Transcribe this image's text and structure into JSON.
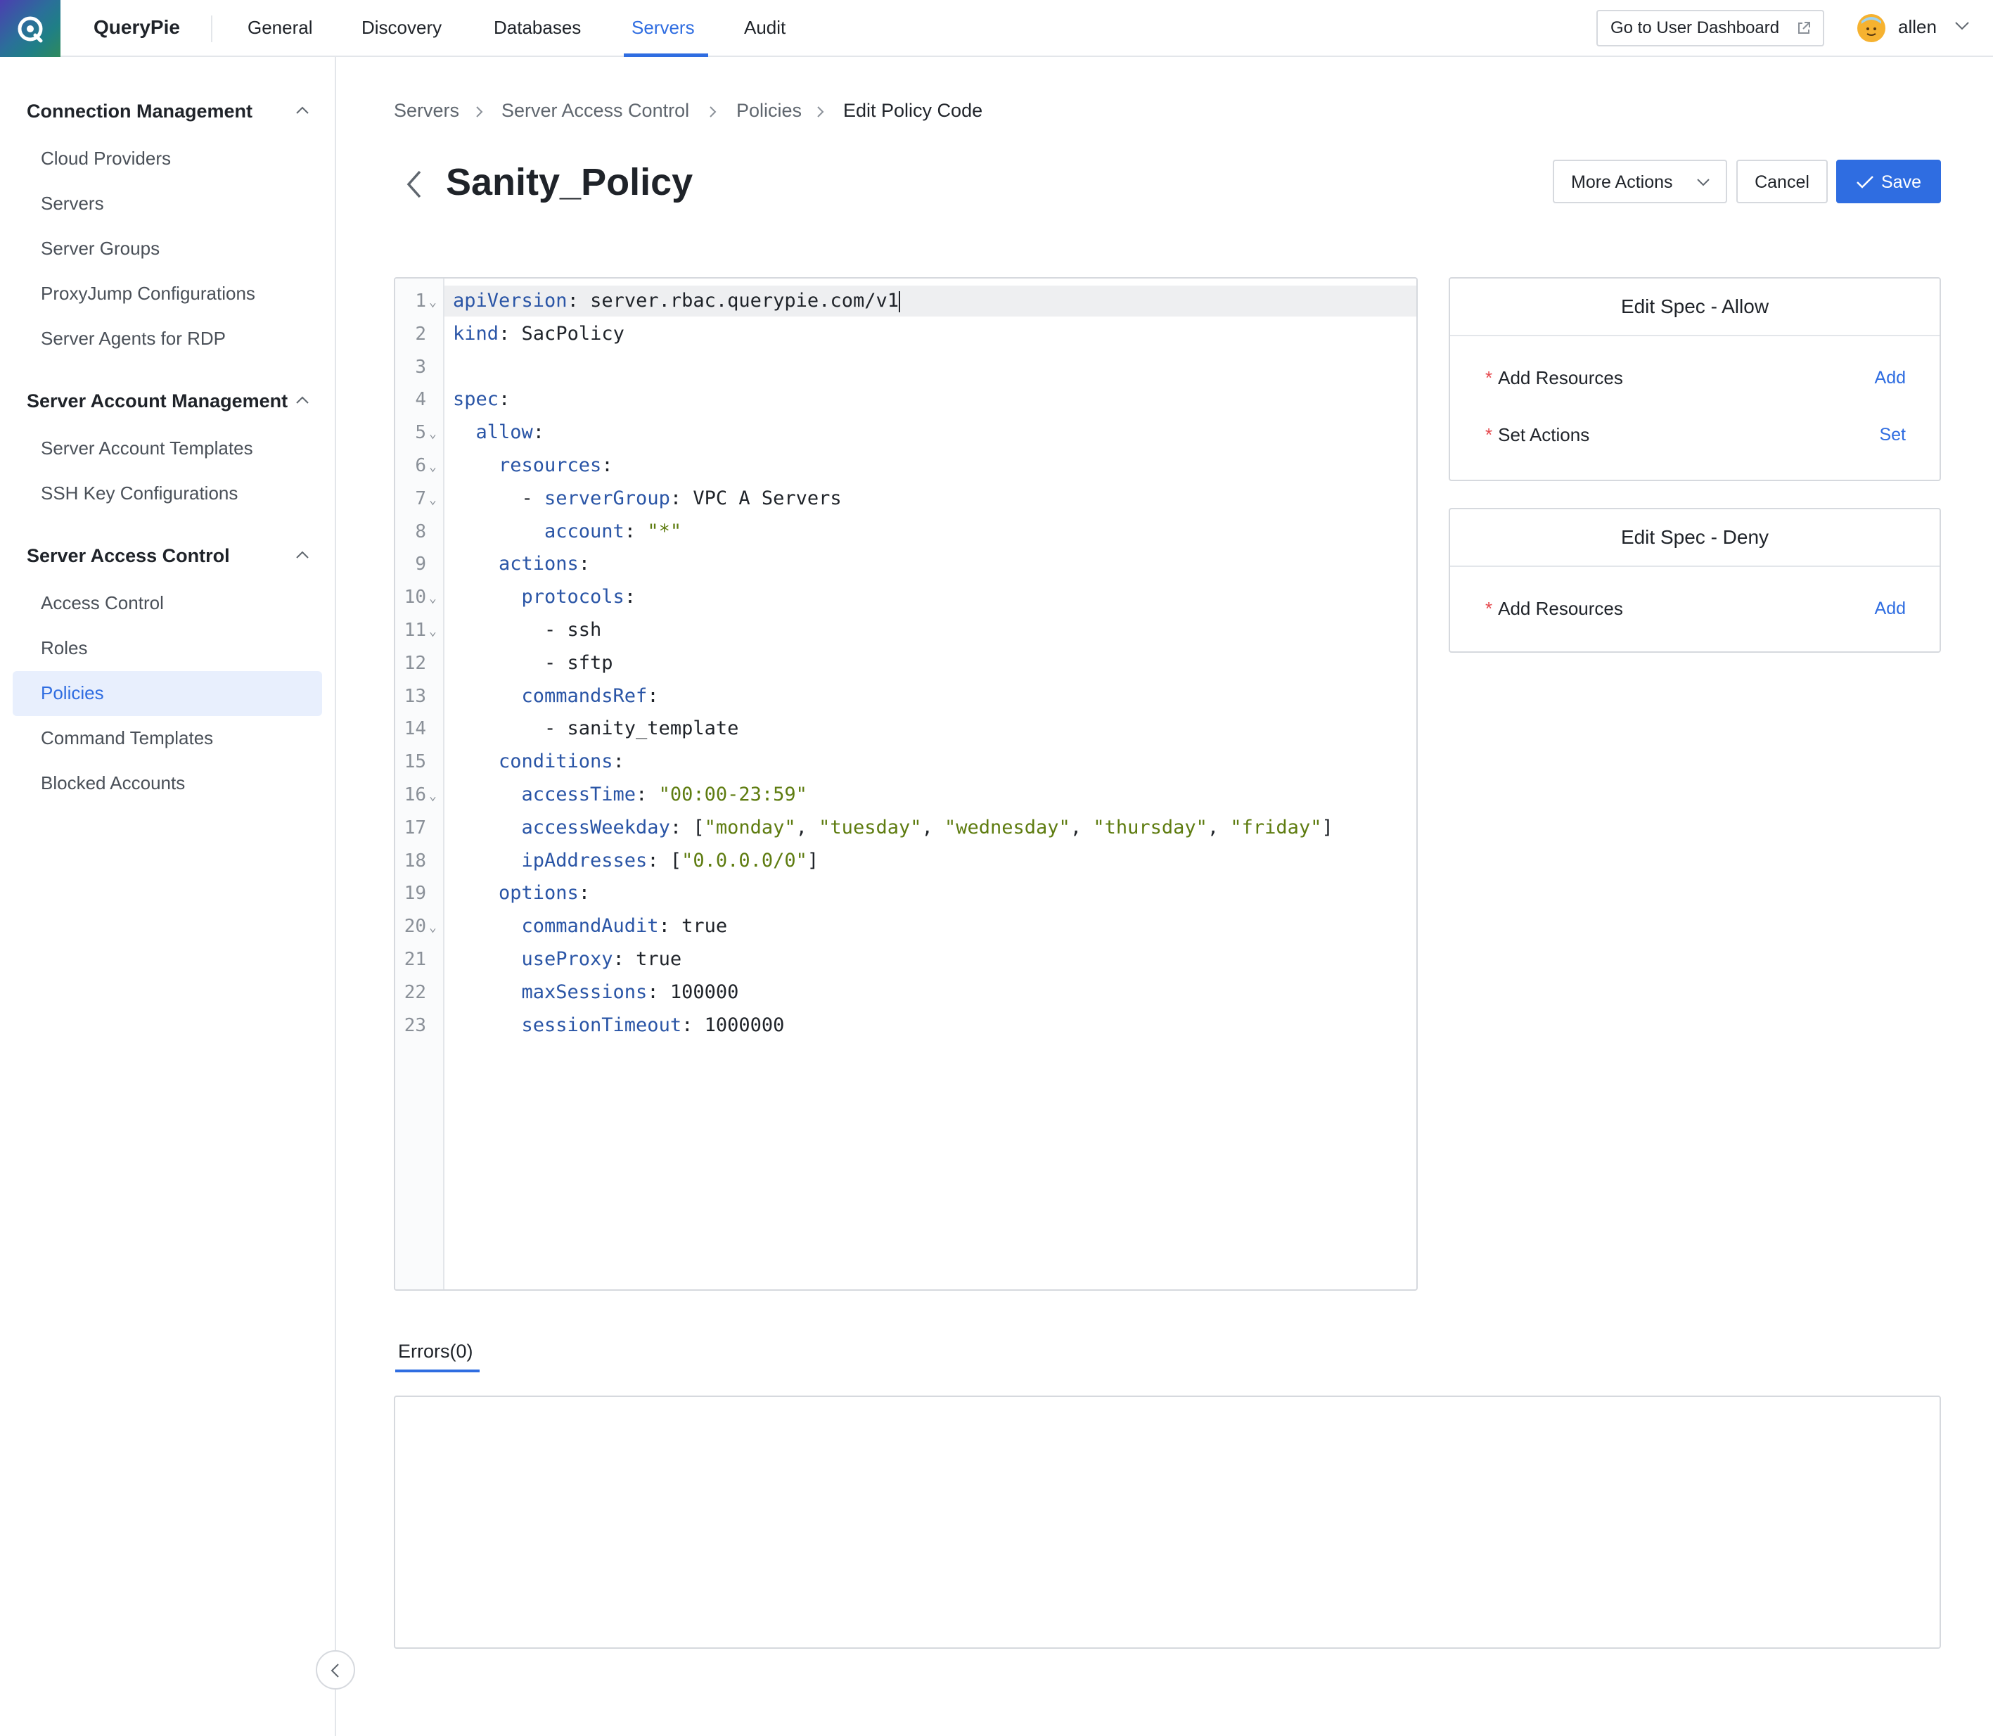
{
  "app": {
    "brand": "QueryPie"
  },
  "nav": {
    "items": [
      "General",
      "Discovery",
      "Databases",
      "Servers",
      "Audit"
    ],
    "active": "Servers"
  },
  "header": {
    "dashboard_label": "Go to User Dashboard",
    "user_name": "allen"
  },
  "sidebar": {
    "groups": [
      {
        "title": "Connection Management",
        "items": [
          "Cloud Providers",
          "Servers",
          "Server Groups",
          "ProxyJump Configurations",
          "Server Agents for RDP"
        ]
      },
      {
        "title": "Server Account Management",
        "items": [
          "Server Account Templates",
          "SSH Key Configurations"
        ]
      },
      {
        "title": "Server Access Control",
        "items": [
          "Access Control",
          "Roles",
          "Policies",
          "Command Templates",
          "Blocked Accounts"
        ]
      }
    ],
    "active_item": "Policies"
  },
  "breadcrumb": [
    "Servers",
    "Server Access Control",
    "Policies",
    "Edit Policy Code"
  ],
  "page": {
    "title": "Sanity_Policy"
  },
  "actions": {
    "more": "More Actions",
    "cancel": "Cancel",
    "save": "Save"
  },
  "editor": {
    "lines": [
      {
        "n": "1",
        "fold": true,
        "indent": 0,
        "key": "apiVersion",
        "sep": ": ",
        "val": "server.rbac.querypie.com/v1",
        "str": false
      },
      {
        "n": "2",
        "fold": false,
        "indent": 0,
        "key": "kind",
        "sep": ": ",
        "val": "SacPolicy",
        "str": false
      },
      {
        "n": "3",
        "fold": false,
        "indent": 0,
        "key": "",
        "sep": "",
        "val": "",
        "str": false
      },
      {
        "n": "4",
        "fold": false,
        "indent": 0,
        "key": "spec",
        "sep": ":",
        "val": "",
        "str": false
      },
      {
        "n": "5",
        "fold": true,
        "indent": 2,
        "key": "allow",
        "sep": ":",
        "val": "",
        "str": false
      },
      {
        "n": "6",
        "fold": true,
        "indent": 4,
        "key": "resources",
        "sep": ":",
        "val": "",
        "str": false
      },
      {
        "n": "7",
        "fold": true,
        "indent": 6,
        "dash": true,
        "key": "serverGroup",
        "sep": ": ",
        "val": "VPC A Servers",
        "str": false
      },
      {
        "n": "8",
        "fold": false,
        "indent": 8,
        "key": "account",
        "sep": ": ",
        "val": "\"*\"",
        "str": true
      },
      {
        "n": "9",
        "fold": false,
        "indent": 4,
        "key": "actions",
        "sep": ":",
        "val": "",
        "str": false
      },
      {
        "n": "10",
        "fold": true,
        "indent": 6,
        "key": "protocols",
        "sep": ":",
        "val": "",
        "str": false
      },
      {
        "n": "11",
        "fold": true,
        "indent": 8,
        "dash": true,
        "key": "",
        "sep": "",
        "val": "ssh",
        "str": false
      },
      {
        "n": "12",
        "fold": false,
        "indent": 8,
        "dash": true,
        "key": "",
        "sep": "",
        "val": "sftp",
        "str": false
      },
      {
        "n": "13",
        "fold": false,
        "indent": 6,
        "key": "commandsRef",
        "sep": ":",
        "val": "",
        "str": false
      },
      {
        "n": "14",
        "fold": false,
        "indent": 8,
        "dash": true,
        "key": "",
        "sep": "",
        "val": "sanity_template",
        "str": false
      },
      {
        "n": "15",
        "fold": false,
        "indent": 4,
        "key": "conditions",
        "sep": ":",
        "val": "",
        "str": false
      },
      {
        "n": "16",
        "fold": true,
        "indent": 6,
        "key": "accessTime",
        "sep": ": ",
        "val": "\"00:00-23:59\"",
        "str": true
      },
      {
        "n": "17",
        "fold": false,
        "indent": 6,
        "key": "accessWeekday",
        "sep": ": ",
        "val": "[\"monday\", \"tuesday\", \"wednesday\", \"thursday\", \"friday\"]",
        "str": true
      },
      {
        "n": "18",
        "fold": false,
        "indent": 6,
        "key": "ipAddresses",
        "sep": ": ",
        "val": "[\"0.0.0.0/0\"]",
        "str": true
      },
      {
        "n": "19",
        "fold": false,
        "indent": 4,
        "key": "options",
        "sep": ":",
        "val": "",
        "str": false
      },
      {
        "n": "20",
        "fold": true,
        "indent": 6,
        "key": "commandAudit",
        "sep": ": ",
        "val": "true",
        "str": false
      },
      {
        "n": "21",
        "fold": false,
        "indent": 6,
        "key": "useProxy",
        "sep": ": ",
        "val": "true",
        "str": false
      },
      {
        "n": "22",
        "fold": false,
        "indent": 6,
        "key": "maxSessions",
        "sep": ": ",
        "val": "100000",
        "str": false
      },
      {
        "n": "23",
        "fold": false,
        "indent": 6,
        "key": "sessionTimeout",
        "sep": ": ",
        "val": "1000000",
        "str": false
      }
    ]
  },
  "spec_allow": {
    "title": "Edit Spec - Allow",
    "rows": [
      {
        "label": "Add Resources",
        "action": "Add"
      },
      {
        "label": "Set Actions",
        "action": "Set"
      }
    ]
  },
  "spec_deny": {
    "title": "Edit Spec - Deny",
    "rows": [
      {
        "label": "Add Resources",
        "action": "Add"
      }
    ]
  },
  "errors": {
    "tab_label": "Errors(0)"
  },
  "colors": {
    "accent": "#2f6de1",
    "key": "#2a55a6",
    "string": "#5e7c10",
    "required": "#e5484d"
  },
  "icons": [
    "querypie-logo-icon",
    "external-link-icon",
    "avatar-face-icon",
    "chevron-down-icon",
    "chevron-up-icon",
    "chevron-right-icon",
    "back-arrow-icon",
    "check-icon",
    "chevron-left-icon"
  ]
}
